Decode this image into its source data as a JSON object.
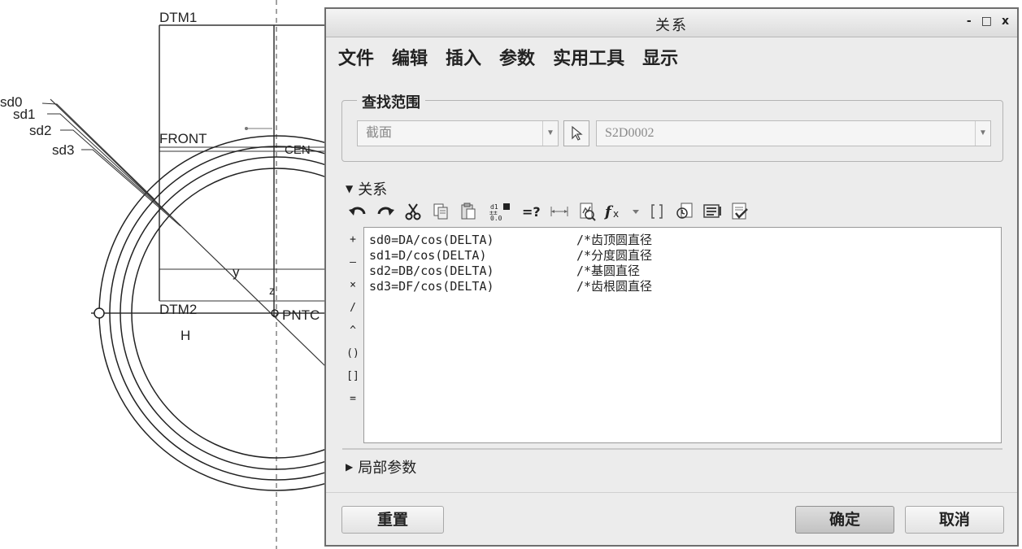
{
  "sketch": {
    "datum_top": "DTM1",
    "datum_front": "FRONT",
    "datum_bottom": "DTM2",
    "label_h": "H",
    "label_pnt": "PNTC",
    "label_cen": "CEN",
    "label_y": "y",
    "label_z": "z",
    "dims": [
      "sd0",
      "sd1",
      "sd2",
      "sd3"
    ]
  },
  "dialog": {
    "title": "关系",
    "window_controls": [
      "-",
      "□",
      "x"
    ],
    "menu": [
      "文件",
      "编辑",
      "插入",
      "参数",
      "实用工具",
      "显示"
    ],
    "search_scope": {
      "legend": "查找范围",
      "type_value": "截面",
      "object_value": "S2D0002"
    },
    "relations_section": {
      "label": "关系"
    },
    "toolbar_icons": [
      "undo-icon",
      "redo-icon",
      "cut-icon",
      "copy-icon",
      "paste-icon",
      "switch-dimensions-icon",
      "evaluate-icon",
      "dimension-icon",
      "verify-icon",
      "function-icon",
      "dropdown-icon",
      "brackets-icon",
      "sort-icon",
      "display-icon",
      "check-icon"
    ],
    "operators": [
      "+",
      "–",
      "×",
      "/",
      "^",
      "()",
      "[]",
      "="
    ],
    "relations": [
      {
        "code": "sd0=DA/cos(DELTA)",
        "comment": "/*齿顶圆直径"
      },
      {
        "code": "sd1=D/cos(DELTA)",
        "comment": "/*分度圆直径"
      },
      {
        "code": "sd2=DB/cos(DELTA)",
        "comment": "/*基圆直径"
      },
      {
        "code": "sd3=DF/cos(DELTA)",
        "comment": "/*齿根圆直径"
      }
    ],
    "local_params": {
      "label": "局部参数"
    },
    "buttons": {
      "reset": "重置",
      "ok": "确定",
      "cancel": "取消"
    }
  }
}
